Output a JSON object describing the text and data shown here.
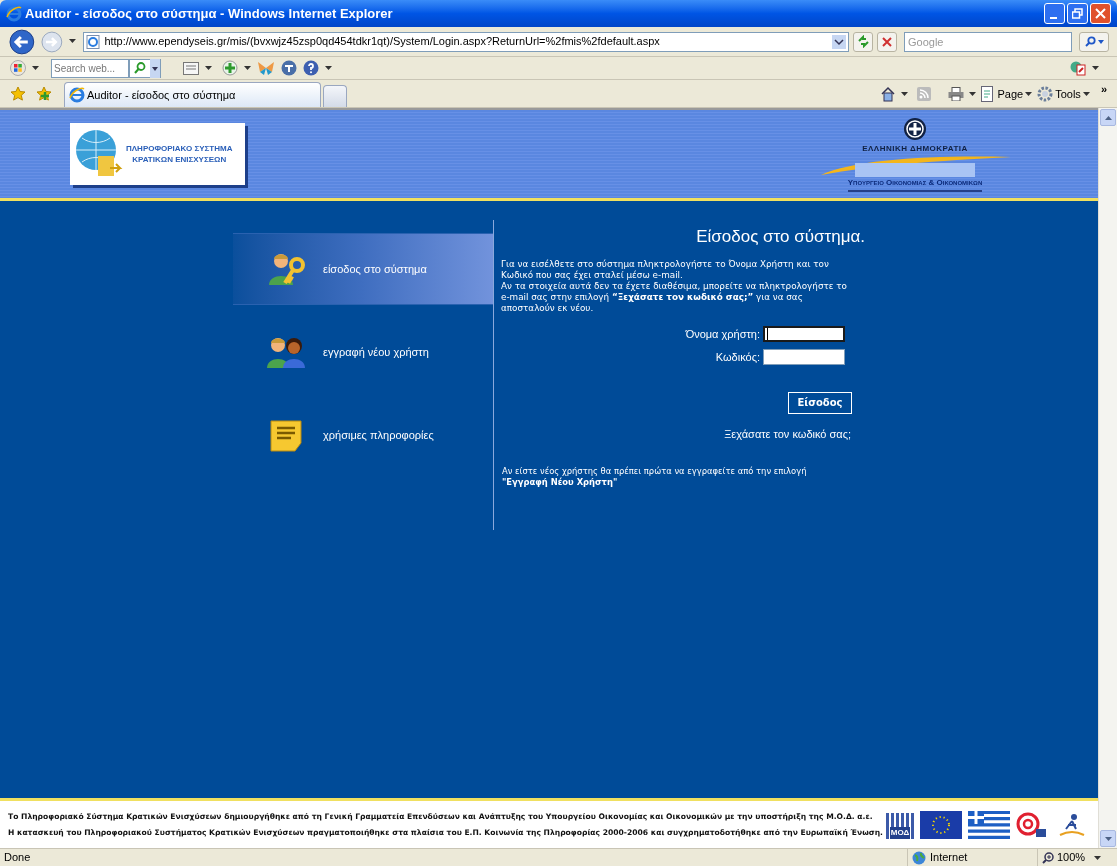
{
  "window": {
    "title": "Auditor - είσοδος στο σύστημα - Windows Internet Explorer"
  },
  "address_bar": {
    "url": "http://www.ependyseis.gr/mis/(bvxwjz45zsp0qd454tdkr1qt)/System/Login.aspx?ReturnUrl=%2fmis%2fdefault.aspx",
    "search_placeholder": "Google"
  },
  "links_bar": {
    "search_placeholder": "Search web..."
  },
  "tabs": [
    {
      "label": "Auditor - είσοδος στο σύστημα",
      "selected": true
    }
  ],
  "command_bar": {
    "page": "Page",
    "tools": "Tools",
    "more": "»"
  },
  "header": {
    "logo_lines": [
      "ΠΛΗΡΟΦΟΡΙΑΚΟ ΣΥΣΤΗΜΑ",
      "ΚΡΑΤΙΚΩΝ ΕΝΙΣΧΥΣΕΩΝ"
    ],
    "republic": "ΕΛΛΗΝΙΚΗ ΔΗΜΟΚΡΑΤΙΑ",
    "ministry": "Υπουργειο Οικονομιας & Οικονομικων"
  },
  "menu": [
    {
      "kind": "login",
      "label": "είσοδος στο σύστημα",
      "selected": true
    },
    {
      "kind": "register",
      "label": "εγγραφή νέου χρήστη",
      "selected": false
    },
    {
      "kind": "info",
      "label": "χρήσιμες πληροφορίες",
      "selected": false
    }
  ],
  "login": {
    "title": "Είσοδος στο σύστημα.",
    "intro": [
      "Για να εισέλθετε στο σύστημα πληκτρολογήστε το Όνομα Χρήστη και τον Κωδικό που σας έχει σταλεί μέσω e-mail.",
      "Αν τα στοιχεία αυτά δεν τα έχετε διαθέσιμα, μπορείτε να πληκτρολογήστε το e-mail σας στην επιλογή **“Ξεχάσατε τον κωδικό σας;”** για να σας αποσταλούν εκ νέου."
    ],
    "fields": [
      {
        "label": "Όνομα χρήστη:",
        "focused": true
      },
      {
        "label": "Κωδικός:",
        "focused": false
      }
    ],
    "submit": "Είσοδος",
    "forgot": "Ξεχάσατε τον κωδικό σας;",
    "new_user_note": "Αν είστε νέος χρήστης θα πρέπει πρώτα να εγγραφείτε από την επιλογή **\"Εγγραφή Νέου Χρήστη\"**"
  },
  "footer": {
    "lines": [
      "Το Πληροφοριακό Σύστημα Κρατικών Ενισχύσεων δημιουργήθηκε από τη Γενική Γραμματεία Επενδύσεων και Ανάπτυξης του Υπουργείου Οικονομίας και Οικονομικών με την υποστήριξη της Μ.Ο.Δ. α.ε.",
      "Η κατασκευή του Πληροφοριακού Συστήματος Κρατικών Ενισχύσεων πραγματοποιήθηκε στα πλαίσια του Ε.Π. Κοινωνία της Πληροφορίας 2000-2006 και συγχρηματοδοτήθηκε από την Ευρωπαϊκή Ένωση."
    ],
    "mod_logo": "ΜΟΔ"
  },
  "status_bar": {
    "text": "Done",
    "zone": "Internet",
    "zoom": "100%"
  }
}
